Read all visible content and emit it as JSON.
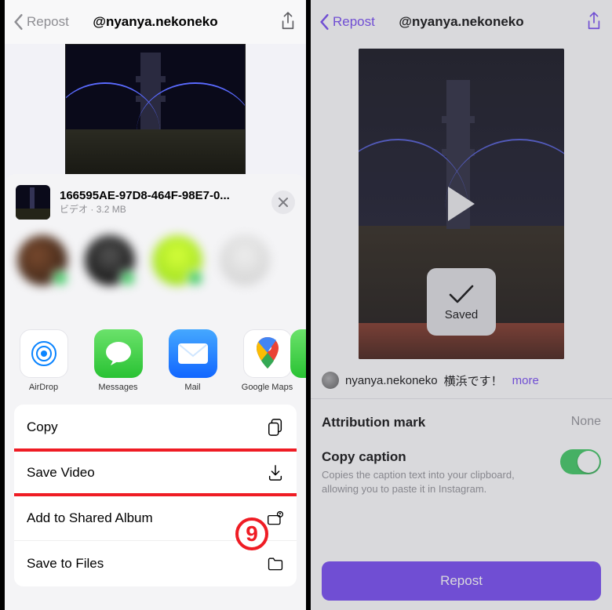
{
  "left": {
    "nav": {
      "back": "Repost",
      "title": "@nyanya.nekoneko"
    },
    "file": {
      "name": "166595AE-97D8-464F-98E7-0...",
      "type": "ビデオ",
      "size": "3.2 MB"
    },
    "apps": {
      "airdrop": "AirDrop",
      "messages": "Messages",
      "mail": "Mail",
      "gmaps": "Google Maps"
    },
    "actions": {
      "copy": "Copy",
      "save_video": "Save Video",
      "shared_album": "Add to Shared Album",
      "save_files": "Save to Files"
    },
    "annotation": "9"
  },
  "right": {
    "nav": {
      "back": "Repost",
      "title": "@nyanya.nekoneko"
    },
    "toast": "Saved",
    "caption": {
      "user": "nyanya.nekoneko",
      "text": "横浜です！",
      "more": "more"
    },
    "settings": {
      "attribution_label": "Attribution mark",
      "attribution_value": "None",
      "copy_caption_label": "Copy caption",
      "copy_caption_desc": "Copies the caption text into your clipboard, allowing you to paste it in Instagram."
    },
    "repost_button": "Repost"
  }
}
